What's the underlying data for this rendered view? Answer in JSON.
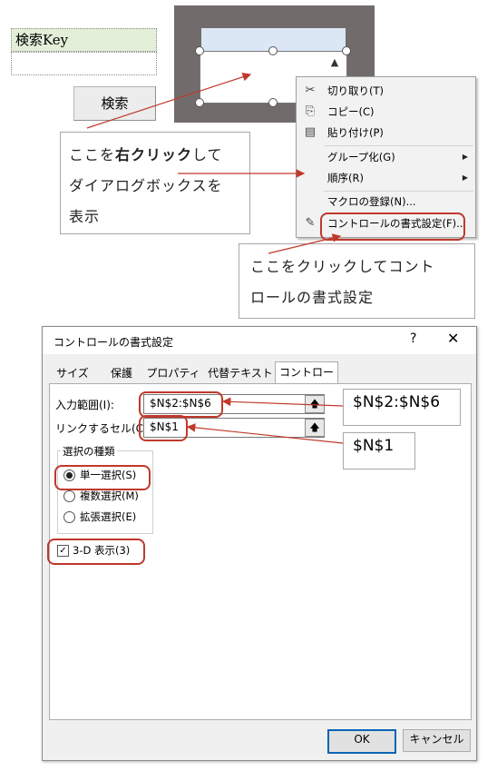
{
  "sheet": {
    "key_cell": "検索Key",
    "search_button": "検索"
  },
  "callouts": {
    "right_click": {
      "prefix": "ここを",
      "bold": "右クリック",
      "suffix_line1": "して",
      "line2": "ダイアログボックスを",
      "line3": "表示"
    },
    "click_here": {
      "line1": "ここをクリックしてコント",
      "line2": "ロールの書式設定"
    }
  },
  "context_menu": {
    "items": [
      {
        "label": "切り取り(T)",
        "icon": "scissors-icon",
        "glyph": "✂"
      },
      {
        "label": "コピー(C)",
        "icon": "copy-icon",
        "glyph": "⎘"
      },
      {
        "label": "貼り付け(P)",
        "icon": "paste-icon",
        "glyph": "📋"
      },
      {
        "label": "グループ化(G)",
        "submenu": true
      },
      {
        "label": "順序(R)",
        "submenu": true
      },
      {
        "label": "マクロの登録(N)..."
      },
      {
        "label": "コントロールの書式設定(F)...",
        "icon": "format-control-icon",
        "glyph": "✎"
      }
    ]
  },
  "dialog": {
    "title": "コントロールの書式設定",
    "help": "?",
    "close": "X",
    "tabs": [
      "サイズ",
      "保護",
      "プロパティ",
      "代替テキスト",
      "コントロール"
    ],
    "active_tab": "コントロール",
    "input_range_label": "入力範囲(I):",
    "input_range_value": "$N$2:$N$6",
    "linked_cell_label": "リンクするセル(C):",
    "linked_cell_value": "$N$1",
    "selection_type_title": "選択の種類",
    "options": [
      {
        "label": "単一選択(S)",
        "selected": true
      },
      {
        "label": "複数選択(M)",
        "selected": false
      },
      {
        "label": "拡張選択(E)",
        "selected": false
      }
    ],
    "checkbox_3d": {
      "label": "3-D 表示(3)",
      "checked": true
    },
    "ok": "OK",
    "cancel": "キャンセル"
  },
  "notes": {
    "range": "$N$2:$N$6",
    "cell": "$N$1"
  },
  "colors": {
    "highlight_red": "#c0392b",
    "arrow_red": "#c0392b",
    "key_cell_bg": "#e4efda",
    "listbox_selection": "#dbe7f5"
  }
}
